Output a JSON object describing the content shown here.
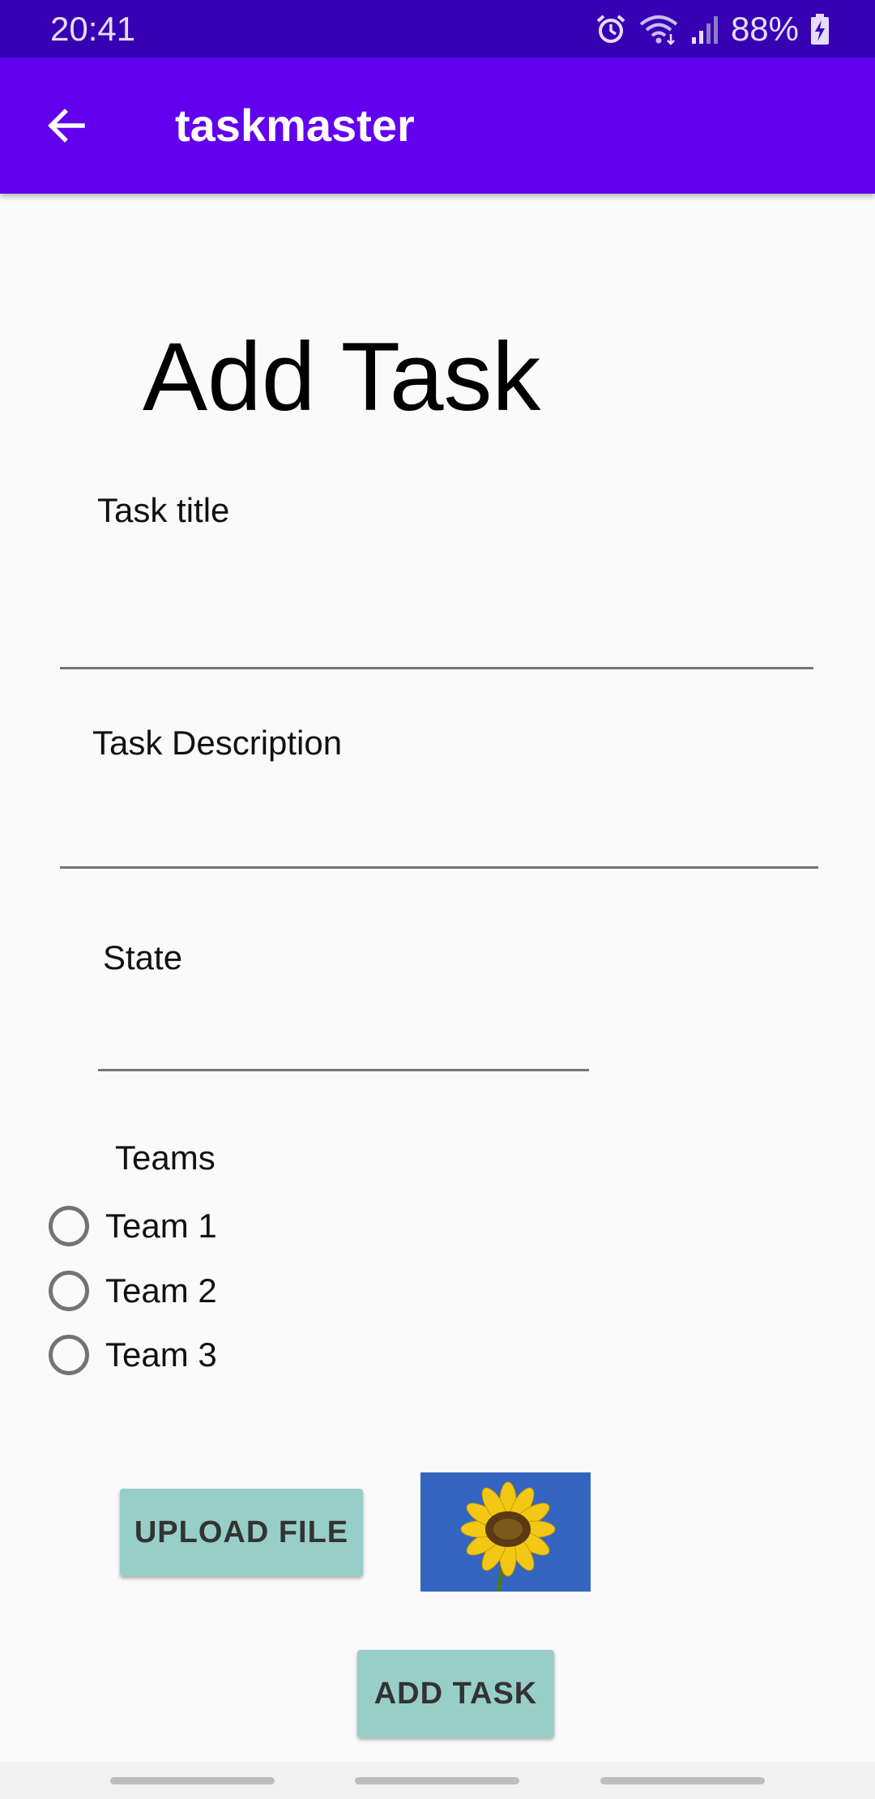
{
  "status_bar": {
    "time": "20:41",
    "battery_percent": "88%",
    "icons": [
      "alarm-icon",
      "wifi-icon",
      "signal-icon",
      "battery-charging-icon"
    ]
  },
  "app_bar": {
    "title": "taskmaster",
    "back_icon": "arrow-back-icon"
  },
  "form": {
    "heading": "Add Task",
    "task_title_label": "Task title",
    "task_title_value": "",
    "task_description_label": "Task Description",
    "task_description_value": "",
    "state_label": "State",
    "state_value": "",
    "teams_label": "Teams",
    "teams": [
      {
        "label": "Team 1",
        "selected": false
      },
      {
        "label": "Team 2",
        "selected": false
      },
      {
        "label": "Team 3",
        "selected": false
      }
    ],
    "upload_button": "UPLOAD FILE",
    "add_button": "ADD TASK"
  },
  "colors": {
    "status_bar": "#3700b3",
    "app_bar": "#6200ee",
    "button": "#98cec8"
  }
}
